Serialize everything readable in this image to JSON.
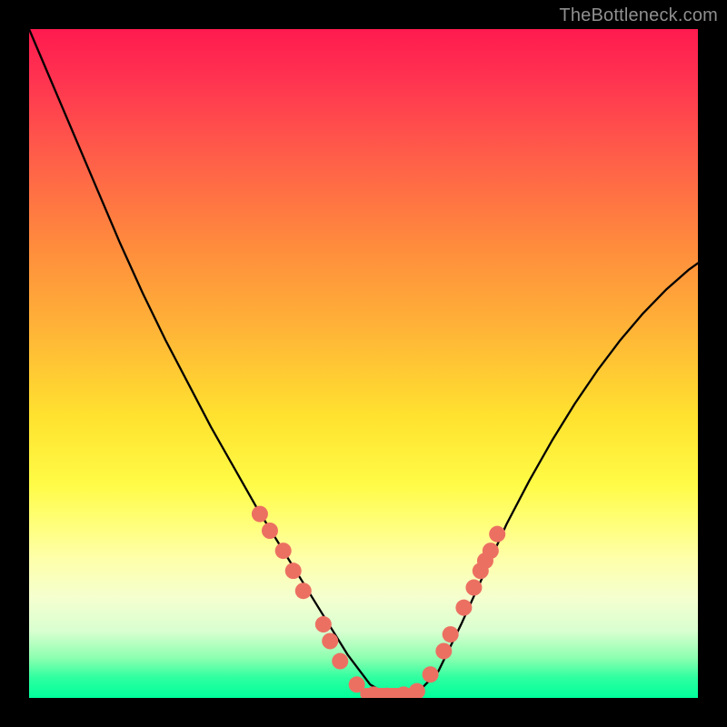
{
  "attribution": "TheBottleneck.com",
  "chart_data": {
    "type": "line",
    "title": "",
    "xlabel": "",
    "ylabel": "",
    "xlim": [
      0,
      100
    ],
    "ylim": [
      0,
      100
    ],
    "grid": false,
    "legend": false,
    "series": [
      {
        "name": "v-curve",
        "color": "#000000",
        "x": [
          0.0,
          3.4,
          6.8,
          10.2,
          13.6,
          17.0,
          20.4,
          23.8,
          27.2,
          30.6,
          34.0,
          37.4,
          40.8,
          44.2,
          47.6,
          51.0,
          54.4,
          57.8,
          61.2,
          64.6,
          68.0,
          71.4,
          74.8,
          78.2,
          81.6,
          85.0,
          88.4,
          91.8,
          95.2,
          98.6,
          100.0
        ],
        "y": [
          100.0,
          92.0,
          84.0,
          76.0,
          68.0,
          60.5,
          53.5,
          47.0,
          40.5,
          34.5,
          28.5,
          23.0,
          17.5,
          12.0,
          6.5,
          2.0,
          0.0,
          0.5,
          4.0,
          11.0,
          18.5,
          26.0,
          32.5,
          38.5,
          44.0,
          49.0,
          53.5,
          57.5,
          61.0,
          64.0,
          65.0
        ]
      }
    ],
    "markers": [
      {
        "name": "points",
        "color": "#ec7062",
        "radius": 9,
        "points": [
          {
            "x": 34.5,
            "y": 27.5
          },
          {
            "x": 36.0,
            "y": 25.0
          },
          {
            "x": 38.0,
            "y": 22.0
          },
          {
            "x": 39.5,
            "y": 19.0
          },
          {
            "x": 41.0,
            "y": 16.0
          },
          {
            "x": 44.0,
            "y": 11.0
          },
          {
            "x": 45.0,
            "y": 8.5
          },
          {
            "x": 46.5,
            "y": 5.5
          },
          {
            "x": 49.0,
            "y": 2.0
          },
          {
            "x": 51.5,
            "y": 0.5
          },
          {
            "x": 53.5,
            "y": 0.3
          },
          {
            "x": 56.0,
            "y": 0.5
          },
          {
            "x": 58.0,
            "y": 1.0
          },
          {
            "x": 60.0,
            "y": 3.5
          },
          {
            "x": 62.0,
            "y": 7.0
          },
          {
            "x": 63.0,
            "y": 9.5
          },
          {
            "x": 65.0,
            "y": 13.5
          },
          {
            "x": 66.5,
            "y": 16.5
          },
          {
            "x": 67.5,
            "y": 19.0
          },
          {
            "x": 68.2,
            "y": 20.5
          },
          {
            "x": 69.0,
            "y": 22.0
          },
          {
            "x": 70.0,
            "y": 24.5
          }
        ]
      }
    ],
    "flat_markers": [
      {
        "name": "bottom-bar",
        "color": "#ec7062",
        "x0": 49.5,
        "x1": 58.0,
        "y": 0.6,
        "height": 1.8
      }
    ],
    "background_gradient": {
      "direction": "vertical",
      "stops": [
        {
          "pos": 0.0,
          "color": "#ff1a4f"
        },
        {
          "pos": 0.18,
          "color": "#ff5a4a"
        },
        {
          "pos": 0.45,
          "color": "#ffb437"
        },
        {
          "pos": 0.68,
          "color": "#fffb46"
        },
        {
          "pos": 0.85,
          "color": "#f5ffcf"
        },
        {
          "pos": 0.97,
          "color": "#2effa0"
        },
        {
          "pos": 1.0,
          "color": "#00ff9b"
        }
      ]
    }
  }
}
